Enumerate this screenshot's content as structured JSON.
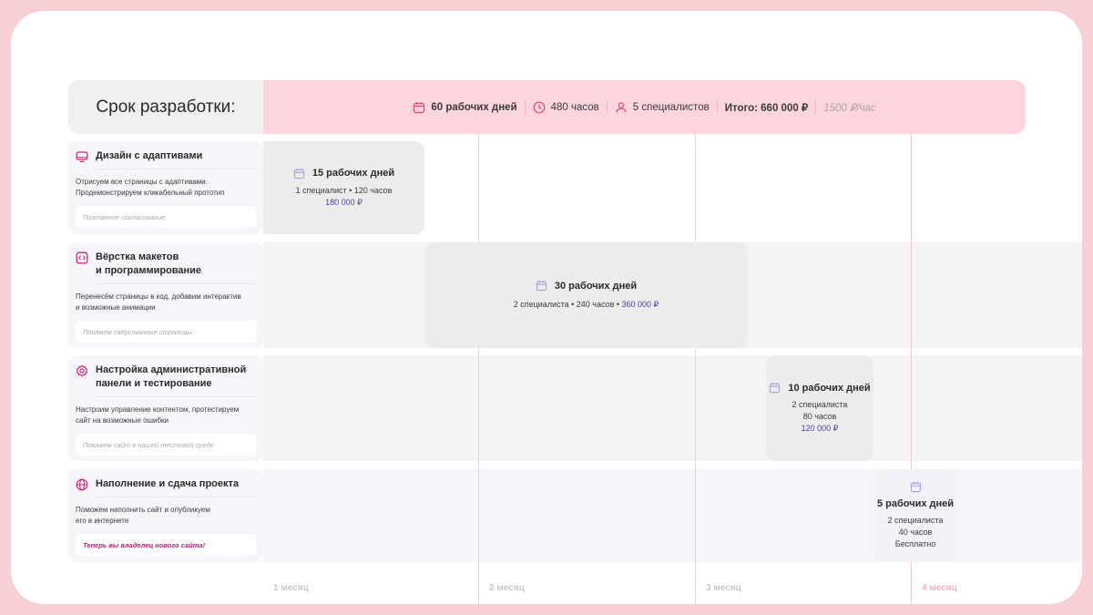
{
  "header": {
    "title": "Срок разработки:",
    "days": "60 рабочих дней",
    "hours": "480 часов",
    "specialists": "5 специалистов",
    "total": "Итого: 660 000 ₽",
    "rate": "1500 ₽/час"
  },
  "tasks": [
    {
      "icon": "monitor-icon",
      "title": "Дизайн с адаптивами",
      "desc1": "Отрисуем все страницы с адаптивами.",
      "desc2": "Продемонстрируем  кликабельный прототип",
      "note": "Поэтапное согласование"
    },
    {
      "icon": "code-icon",
      "title1": "Вёрстка макетов",
      "title2": "и программирование",
      "desc1": "Перенесём страницы в код, добавим интерактив",
      "desc2": "и возможные анимации",
      "note": "Покажем свёрстанные страницы"
    },
    {
      "icon": "gear-icon",
      "title1": "Настройка административной",
      "title2": "панели и тестирование",
      "desc1": "Настроим управление контентом, протестируем",
      "desc2": "сайт на возможные ошибки",
      "note": "Покажем сайт в нашей тестовой среде"
    },
    {
      "icon": "globe-icon",
      "title": "Наполнение и сдача проекта",
      "desc1": "Поможем наполнить сайт и опубликуем",
      "desc2": "его в интернете",
      "note": "Теперь вы владелец нового сайта!"
    }
  ],
  "blocks": [
    {
      "days": "15 рабочих дней",
      "info": "1 специалист • 120 часов",
      "price": "180 000 ₽"
    },
    {
      "days": "30 рабочих дней",
      "info": "2 специалиста • 240 часов • ",
      "price": "360 000 ₽"
    },
    {
      "days": "10 рабочих дней",
      "line1": "2 специалиста",
      "line2": "80 часов",
      "price": "120 000 ₽"
    },
    {
      "days": "5 рабочих дней",
      "line1": "2 специалиста",
      "line2": "40 часов",
      "price": "Бесплатно"
    }
  ],
  "months": [
    "1 месяц",
    "2 месяц",
    "3 месяц",
    "4 месяц"
  ],
  "colors": {
    "accent": "#e0457b",
    "price": "#4b3f9a",
    "header_pink": "#fcd6dc",
    "page_bg": "#f9cfd6"
  }
}
